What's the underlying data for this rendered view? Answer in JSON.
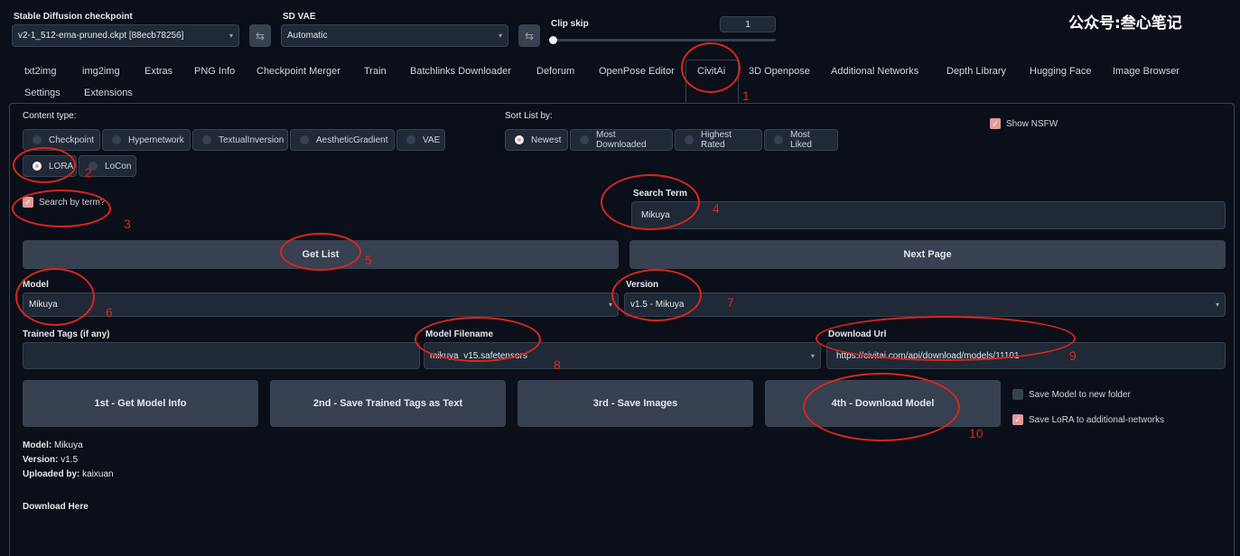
{
  "top": {
    "checkpoint_label": "Stable Diffusion checkpoint",
    "checkpoint_value": "v2-1_512-ema-pruned.ckpt [88ecb78256]",
    "vae_label": "SD VAE",
    "vae_value": "Automatic",
    "clip_label": "Clip skip",
    "clip_value": "1",
    "clip_fraction": 0.0,
    "watermark": "公众号:叁心笔记"
  },
  "tabs": [
    "txt2img",
    "img2img",
    "Extras",
    "PNG Info",
    "Checkpoint Merger",
    "Train",
    "Batchlinks Downloader",
    "Deforum",
    "OpenPose Editor",
    "CivitAi",
    "3D Openpose",
    "Additional Networks",
    "Depth Library",
    "Hugging Face",
    "Image Browser",
    "Settings",
    "Extensions"
  ],
  "content": {
    "content_type_label": "Content type:",
    "types": [
      "Checkpoint",
      "Hypernetwork",
      "TextualInversion",
      "AestheticGradient",
      "VAE",
      "LORA",
      "LoCon"
    ],
    "sort_label": "Sort List by:",
    "sorts": [
      "Newest",
      "Most Downloaded",
      "Highest Rated",
      "Most Liked"
    ],
    "show_nsfw": "Show NSFW",
    "search_by_term": "Search by term?",
    "search_term_label": "Search Term",
    "search_term_value": "Mikuya",
    "get_list": "Get List",
    "next_page": "Next Page",
    "model_label": "Model",
    "model_value": "Mikuya",
    "version_label": "Version",
    "version_value": "v1.5 - Mikuya",
    "trained_tags_label": "Trained Tags (if any)",
    "model_filename_label": "Model Filename",
    "model_filename_value": "mikuya_v15.safetensors",
    "download_url_label": "Download Url",
    "download_url_value": "https://civitai.com/api/download/models/11101",
    "btn1": "1st - Get Model Info",
    "btn2": "2nd - Save Trained Tags as Text",
    "btn3": "3rd - Save Images",
    "btn4": "4th - Download Model",
    "save_new_folder": "Save Model to new folder",
    "save_lora": "Save LoRA to additional-networks",
    "info_model_k": "Model:",
    "info_model_v": "Mikuya",
    "info_version_k": "Version:",
    "info_version_v": "v1.5",
    "info_uploader_k": "Uploaded by:",
    "info_uploader_v": "kaixuan",
    "download_here": "Download Here"
  },
  "annotations": [
    "1",
    "2",
    "3",
    "4",
    "5",
    "6",
    "7",
    "8",
    "9",
    "10"
  ],
  "colors": {
    "background": "#0b0f19",
    "annotation": "#d9261c",
    "checked": "#e39a9a"
  }
}
